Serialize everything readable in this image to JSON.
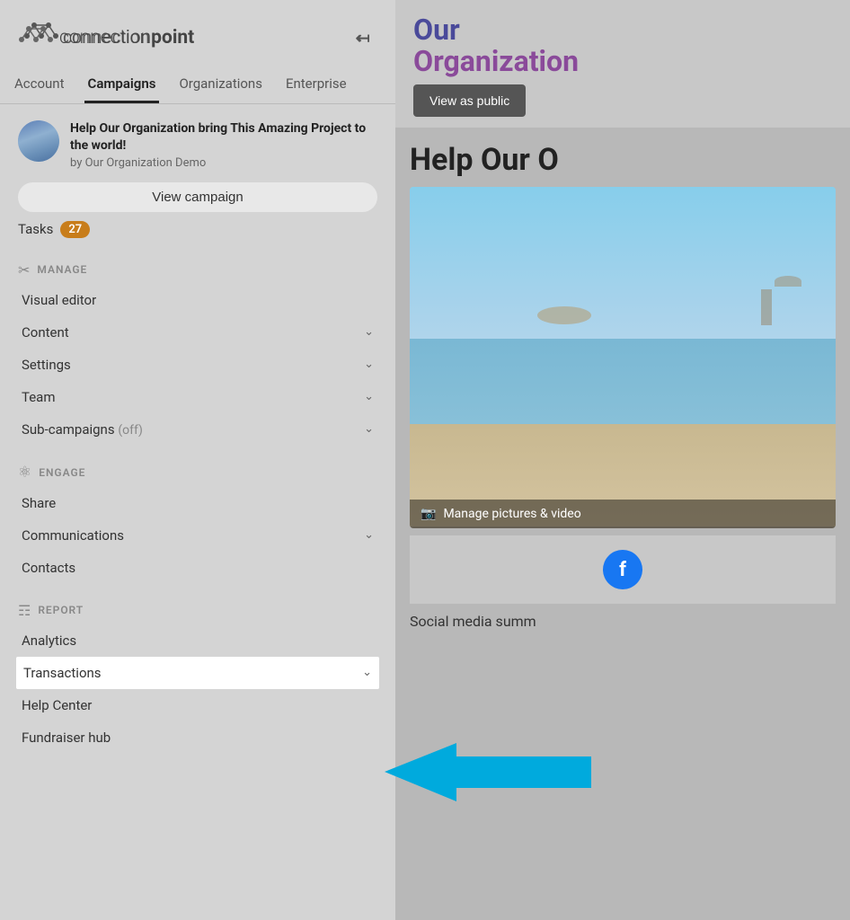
{
  "sidebar": {
    "logo_text_connection": "connection",
    "logo_text_point": "point",
    "nav": {
      "tabs": [
        {
          "id": "account",
          "label": "Account",
          "active": false
        },
        {
          "id": "campaigns",
          "label": "Campaigns",
          "active": true
        },
        {
          "id": "organizations",
          "label": "Organizations",
          "active": false
        },
        {
          "id": "enterprise",
          "label": "Enterprise",
          "active": false
        }
      ]
    },
    "campaign": {
      "title": "Help Our Organization bring This Amazing Project to the world!",
      "org": "by Our Organization Demo",
      "view_btn": "View campaign",
      "tasks_label": "Tasks",
      "tasks_count": "27"
    },
    "manage": {
      "section_label": "MANAGE",
      "items": [
        {
          "id": "visual-editor",
          "label": "Visual editor",
          "has_chevron": false
        },
        {
          "id": "content",
          "label": "Content",
          "has_chevron": true
        },
        {
          "id": "settings",
          "label": "Settings",
          "has_chevron": true
        },
        {
          "id": "team",
          "label": "Team",
          "has_chevron": true
        },
        {
          "id": "sub-campaigns",
          "label": "Sub-campaigns",
          "sub_text": "(off)",
          "has_chevron": true
        }
      ]
    },
    "engage": {
      "section_label": "ENGAGE",
      "items": [
        {
          "id": "share",
          "label": "Share",
          "has_chevron": false
        },
        {
          "id": "communications",
          "label": "Communications",
          "has_chevron": true
        },
        {
          "id": "contacts",
          "label": "Contacts",
          "has_chevron": false
        }
      ]
    },
    "report": {
      "section_label": "REPORT",
      "items": [
        {
          "id": "analytics",
          "label": "Analytics",
          "has_chevron": false
        },
        {
          "id": "transactions",
          "label": "Transactions",
          "has_chevron": true,
          "highlighted": true
        },
        {
          "id": "help-center",
          "label": "Help Center",
          "has_chevron": false
        },
        {
          "id": "fundraiser-hub",
          "label": "Fundraiser hub",
          "has_chevron": false
        }
      ]
    }
  },
  "right_panel": {
    "org_title_line1": "Our",
    "org_title_line2": "Organization",
    "view_public_btn": "View as public",
    "help_our_heading": "Help Our O",
    "manage_pics_label": "Manage pictures & video",
    "social_media_label": "Social media summ",
    "fb_icon": "f"
  },
  "arrow": {
    "color": "#00AADD"
  },
  "colors": {
    "accent_purple": "#4a4a9a",
    "accent_magenta": "#8a4a9a",
    "tasks_badge": "#c87d1a",
    "fb_blue": "#1877F2",
    "arrow_blue": "#00AADD"
  }
}
